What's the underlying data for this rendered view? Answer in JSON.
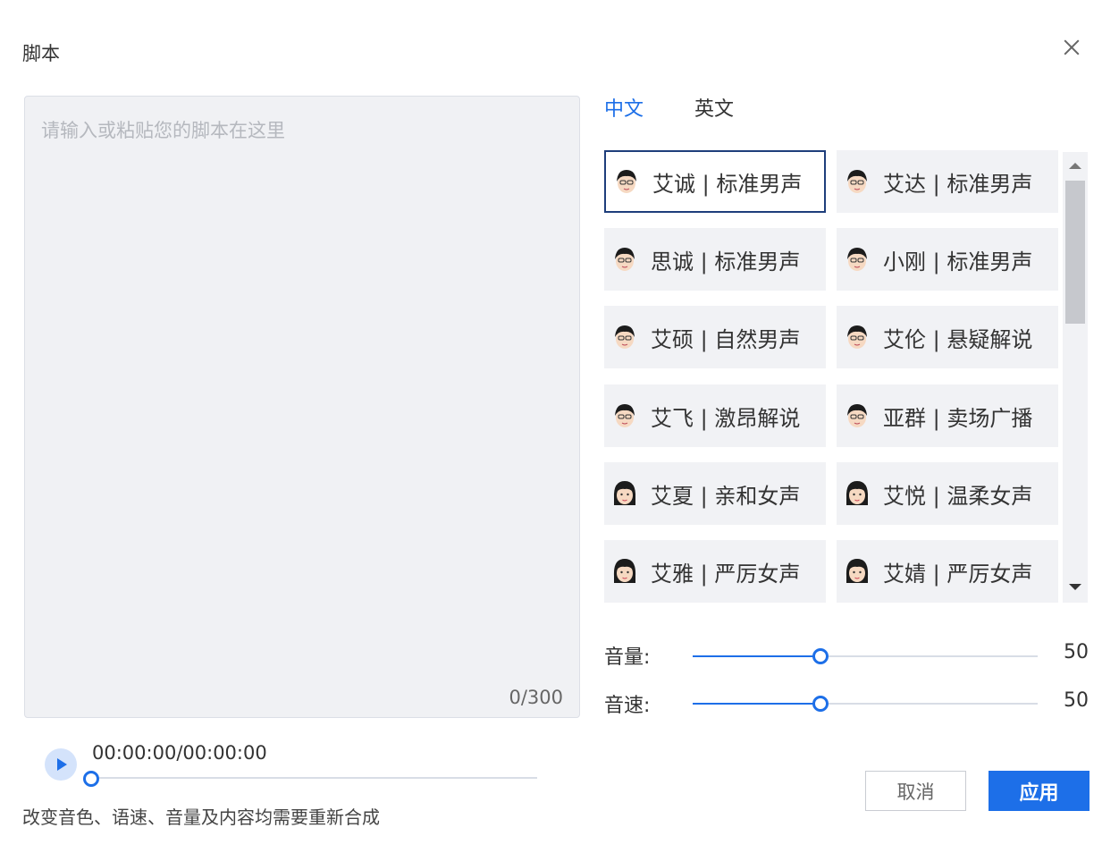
{
  "dialog": {
    "title": "脚本"
  },
  "script": {
    "placeholder": "请输入或粘贴您的脚本在这里",
    "value": "",
    "char_count": "0/300"
  },
  "player": {
    "time": "00:00:00/00:00:00",
    "progress": 0
  },
  "note": "改变音色、语速、音量及内容均需要重新合成",
  "language_tabs": [
    {
      "label": "中文",
      "active": true
    },
    {
      "label": "英文",
      "active": false
    }
  ],
  "voices": [
    {
      "label": "艾诚 | 标准男声",
      "gender": "male",
      "selected": true
    },
    {
      "label": "艾达 | 标准男声",
      "gender": "male",
      "selected": false
    },
    {
      "label": "思诚 | 标准男声",
      "gender": "male",
      "selected": false
    },
    {
      "label": "小刚 | 标准男声",
      "gender": "male",
      "selected": false
    },
    {
      "label": "艾硕 | 自然男声",
      "gender": "male",
      "selected": false
    },
    {
      "label": "艾伦 | 悬疑解说",
      "gender": "male",
      "selected": false
    },
    {
      "label": "艾飞 | 激昂解说",
      "gender": "male",
      "selected": false
    },
    {
      "label": "亚群 | 卖场广播",
      "gender": "male",
      "selected": false
    },
    {
      "label": "艾夏 | 亲和女声",
      "gender": "female",
      "selected": false
    },
    {
      "label": "艾悦 | 温柔女声",
      "gender": "female",
      "selected": false
    },
    {
      "label": "艾雅 | 严厉女声",
      "gender": "female",
      "selected": false
    },
    {
      "label": "艾婧 | 严厉女声",
      "gender": "female",
      "selected": false
    }
  ],
  "sliders": {
    "volume": {
      "label": "音量:",
      "value": "50",
      "fraction": 0.37
    },
    "speed": {
      "label": "音速:",
      "value": "50",
      "fraction": 0.37
    }
  },
  "buttons": {
    "cancel": "取消",
    "apply": "应用"
  },
  "colors": {
    "accent": "#1d6fe8",
    "selected_border": "#1e3e7b",
    "panel_bg": "#f1f2f5"
  },
  "icons": {
    "close": "close-icon",
    "play": "play-icon",
    "scroll_up": "scroll-up-arrow",
    "scroll_down": "scroll-down-arrow"
  }
}
